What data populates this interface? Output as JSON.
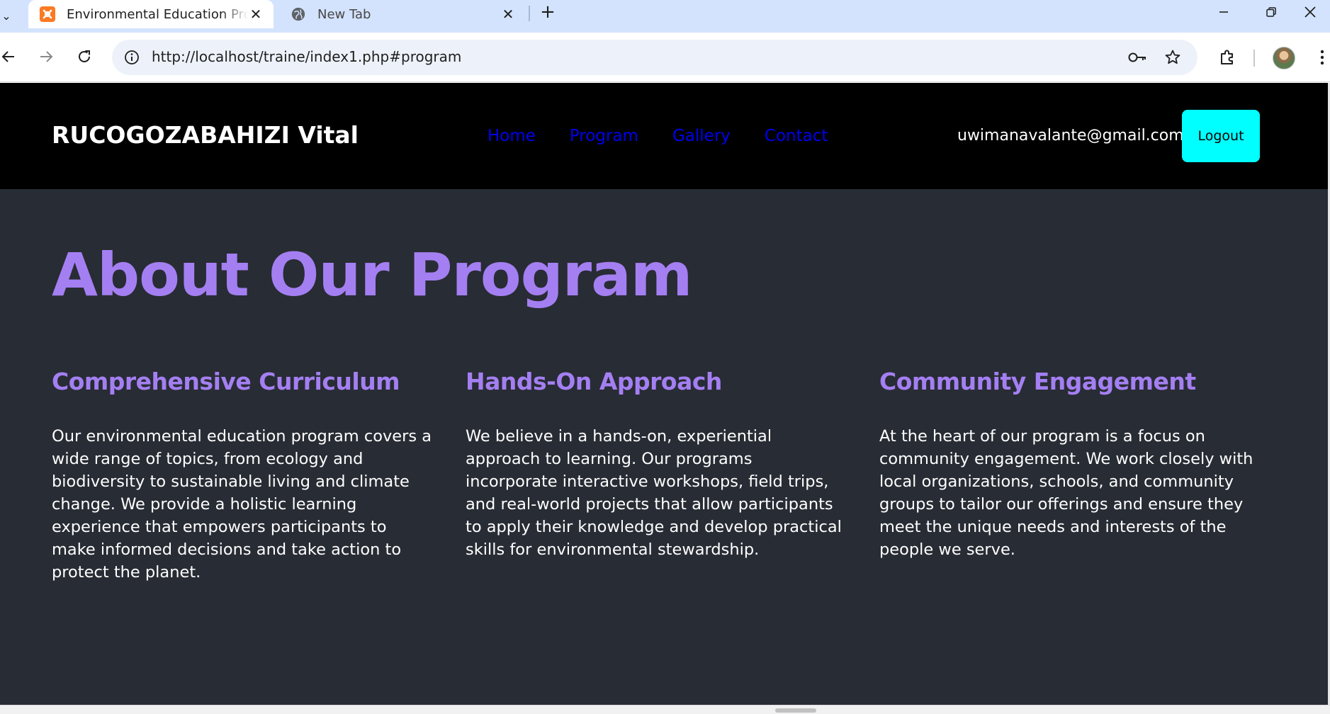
{
  "browser": {
    "tabs": [
      {
        "title": "Environmental Education Program",
        "active": true
      },
      {
        "title": "New Tab",
        "active": false
      }
    ],
    "url": "http://localhost/traine/index1.php#program"
  },
  "header": {
    "brand": "RUCOGOZABAHIZI Vital",
    "nav": [
      "Home",
      "Program",
      "Gallery",
      "Contact"
    ],
    "user_email": "uwimanavalante@gmail.com",
    "logout_label": "Logout"
  },
  "program": {
    "title": "About Our Program",
    "columns": [
      {
        "heading": "Comprehensive Curriculum",
        "text": "Our environmental education program covers a wide range of topics, from ecology and biodiversity to sustainable living and climate change. We provide a holistic learning experience that empowers participants to make informed decisions and take action to protect the planet."
      },
      {
        "heading": "Hands-On Approach",
        "text": "We believe in a hands-on, experiential approach to learning. Our programs incorporate interactive workshops, field trips, and real-world projects that allow participants to apply their knowledge and develop practical skills for environmental stewardship."
      },
      {
        "heading": "Community Engagement",
        "text": "At the heart of our program is a focus on community engagement. We work closely with local organizations, schools, and community groups to tailor our offerings and ensure they meet the unique needs and interests of the people we serve."
      }
    ]
  },
  "colors": {
    "header_bg": "#000000",
    "page_bg": "#282c34",
    "accent": "#a47ff2",
    "nav_link": "#0000ee",
    "logout_bg": "#00ffff"
  }
}
